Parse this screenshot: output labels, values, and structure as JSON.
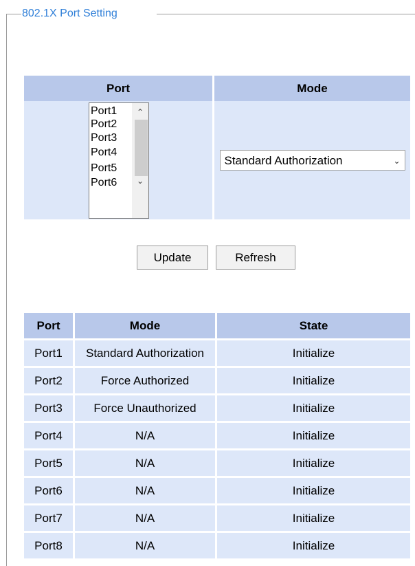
{
  "section": {
    "legend": "802.1X Port Setting"
  },
  "settings": {
    "port_header": "Port",
    "mode_header": "Mode",
    "port_list": [
      "Port1",
      "Port2",
      "Port3",
      "Port4",
      "Port5",
      "Port6"
    ],
    "mode_selected": "Standard Authorization"
  },
  "buttons": {
    "update": "Update",
    "refresh": "Refresh"
  },
  "status_table": {
    "headers": [
      "Port",
      "Mode",
      "State"
    ],
    "rows": [
      [
        "Port1",
        "Standard Authorization",
        "Initialize"
      ],
      [
        "Port2",
        "Force Authorized",
        "Initialize"
      ],
      [
        "Port3",
        "Force Unauthorized",
        "Initialize"
      ],
      [
        "Port4",
        "N/A",
        "Initialize"
      ],
      [
        "Port5",
        "N/A",
        "Initialize"
      ],
      [
        "Port6",
        "N/A",
        "Initialize"
      ],
      [
        "Port7",
        "N/A",
        "Initialize"
      ],
      [
        "Port8",
        "N/A",
        "Initialize"
      ]
    ]
  },
  "colors": {
    "legend": "#2f7fd8",
    "header_bg": "#b8c8ea",
    "row_bg": "#dde7f9"
  }
}
